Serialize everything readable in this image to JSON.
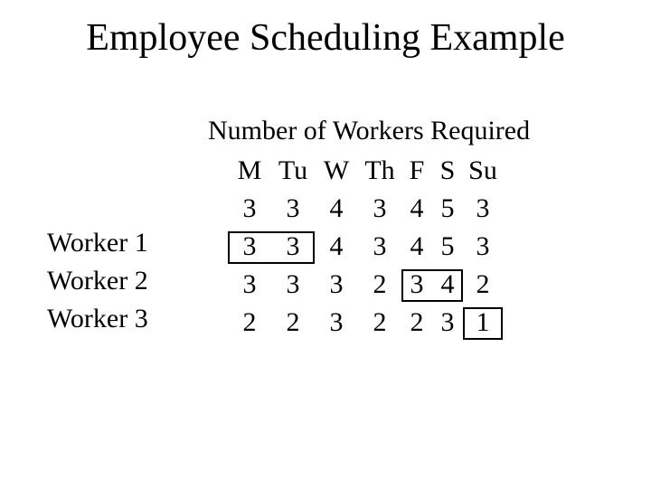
{
  "title": "Employee Scheduling Example",
  "subtitle": "Number of Workers Required",
  "labels": {
    "w1": "Worker 1",
    "w2": "Worker 2",
    "w3": "Worker 3"
  },
  "headers": {
    "m": "M",
    "tu": "Tu",
    "w": "W",
    "th": "Th",
    "f": "F",
    "s": "S",
    "su": "Su"
  },
  "rows": {
    "r0": {
      "m": "3",
      "tu": "3",
      "w": "4",
      "th": "3",
      "f": "4",
      "s": "5",
      "su": "3"
    },
    "r1": {
      "m": "3",
      "tu": "3",
      "w": "4",
      "th": "3",
      "f": "4",
      "s": "5",
      "su": "3"
    },
    "r2": {
      "m": "3",
      "tu": "3",
      "w": "3",
      "th": "2",
      "f": "3",
      "s": "4",
      "su": "2"
    },
    "r3": {
      "m": "2",
      "tu": "2",
      "w": "3",
      "th": "2",
      "f": "2",
      "s": "3",
      "su": "1"
    }
  },
  "chart_data": {
    "type": "table",
    "title": "Employee Scheduling Example — Number of Workers Required",
    "columns": [
      "M",
      "Tu",
      "W",
      "Th",
      "F",
      "S",
      "Su"
    ],
    "rows": [
      {
        "label": "Required",
        "values": [
          3,
          3,
          4,
          3,
          4,
          5,
          3
        ]
      },
      {
        "label": "Worker 1",
        "values": [
          3,
          3,
          4,
          3,
          4,
          5,
          3
        ],
        "boxed_days": [
          "M",
          "Tu"
        ]
      },
      {
        "label": "Worker 2",
        "values": [
          3,
          3,
          3,
          2,
          3,
          4,
          2
        ],
        "boxed_days": [
          "F",
          "S"
        ]
      },
      {
        "label": "Worker 3",
        "values": [
          2,
          2,
          3,
          2,
          2,
          3,
          1
        ],
        "boxed_days": [
          "Su"
        ]
      }
    ]
  }
}
